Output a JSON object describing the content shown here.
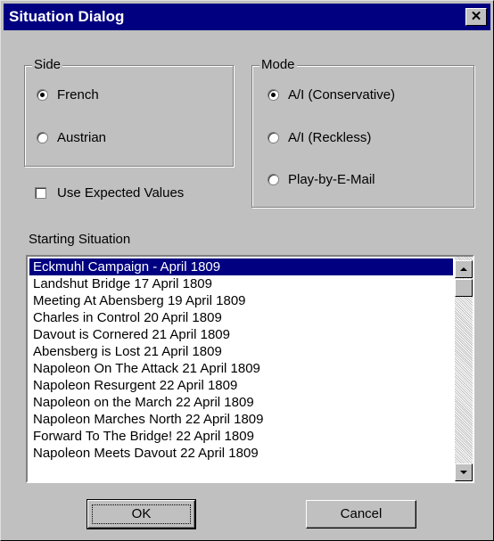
{
  "window": {
    "title": "Situation Dialog",
    "close_label": "✕"
  },
  "side": {
    "legend": "Side",
    "options": [
      {
        "label": "French",
        "checked": true
      },
      {
        "label": "Austrian",
        "checked": false
      }
    ]
  },
  "mode": {
    "legend": "Mode",
    "options": [
      {
        "label": "A/I (Conservative)",
        "checked": true
      },
      {
        "label": "A/I (Reckless)",
        "checked": false
      },
      {
        "label": "Play-by-E-Mail",
        "checked": false
      }
    ]
  },
  "use_expected_values": {
    "label": "Use Expected Values",
    "checked": false
  },
  "starting_situation": {
    "label": "Starting Situation",
    "selected_index": 0,
    "items": [
      "Eckmuhl Campaign - April 1809",
      "Landshut Bridge 17 April 1809",
      "Meeting At Abensberg 19 April 1809",
      "Charles in Control 20 April 1809",
      "Davout is Cornered 21 April 1809",
      "Abensberg is Lost 21 April 1809",
      "Napoleon On The Attack 21 April 1809",
      "Napoleon Resurgent 22 April 1809",
      "Napoleon on the March 22 April 1809",
      "Napoleon Marches North 22 April 1809",
      "Forward To The Bridge! 22 April 1809",
      "Napoleon Meets Davout 22 April 1809"
    ]
  },
  "buttons": {
    "ok": "OK",
    "cancel": "Cancel"
  }
}
